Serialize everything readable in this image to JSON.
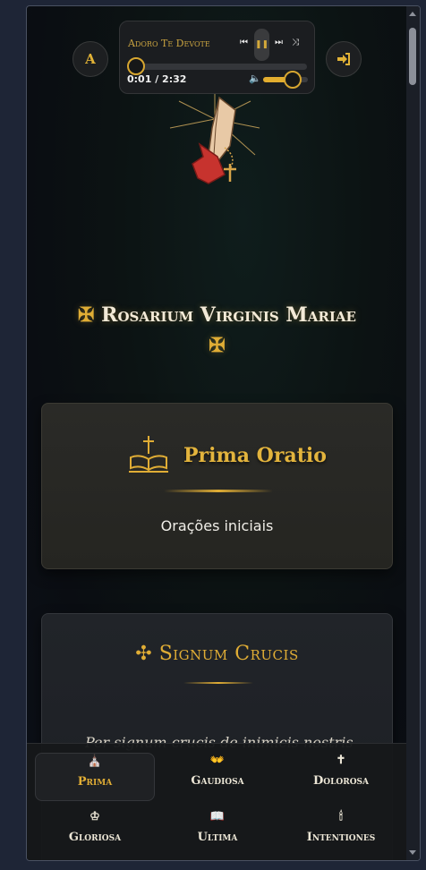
{
  "player": {
    "track_title": "Adoro Te Devote",
    "time": "0:01 / 2:32",
    "progress": 0.0066,
    "volume": 0.75,
    "icons": {
      "prev": "skip-previous-icon",
      "pause": "pause-icon",
      "next": "skip-next-icon",
      "shuffle": "shuffle-icon",
      "volume": "volume-icon"
    }
  },
  "header": {
    "font_button_label": "A",
    "login_icon": "sign-in-icon"
  },
  "page": {
    "title_cross_left": "✠",
    "title": "Rosarium Virginis Mariae",
    "title_cross_right": "✠"
  },
  "cards": [
    {
      "title": "Prima Oratio",
      "subtitle": "Orações iniciais",
      "icon": "bible-cross-icon"
    },
    {
      "title_cross": "✣",
      "title": "Signum Crucis",
      "text": "Per signum crucis de inimicis nostris"
    }
  ],
  "nav": {
    "items": [
      {
        "label": "Prima",
        "icon": "⛪"
      },
      {
        "label": "Gaudiosa",
        "icon": "👐"
      },
      {
        "label": "Dolorosa",
        "icon": "✝"
      },
      {
        "label": "Gloriosa",
        "icon": "♔"
      },
      {
        "label": "Ultima",
        "icon": "📖"
      },
      {
        "label": "Intentiones",
        "icon": "🕯"
      }
    ],
    "active_index": 0
  },
  "colors": {
    "accent_gold": "#e0ad35",
    "background": "#0c1313",
    "text_light": "#f3ead7"
  }
}
